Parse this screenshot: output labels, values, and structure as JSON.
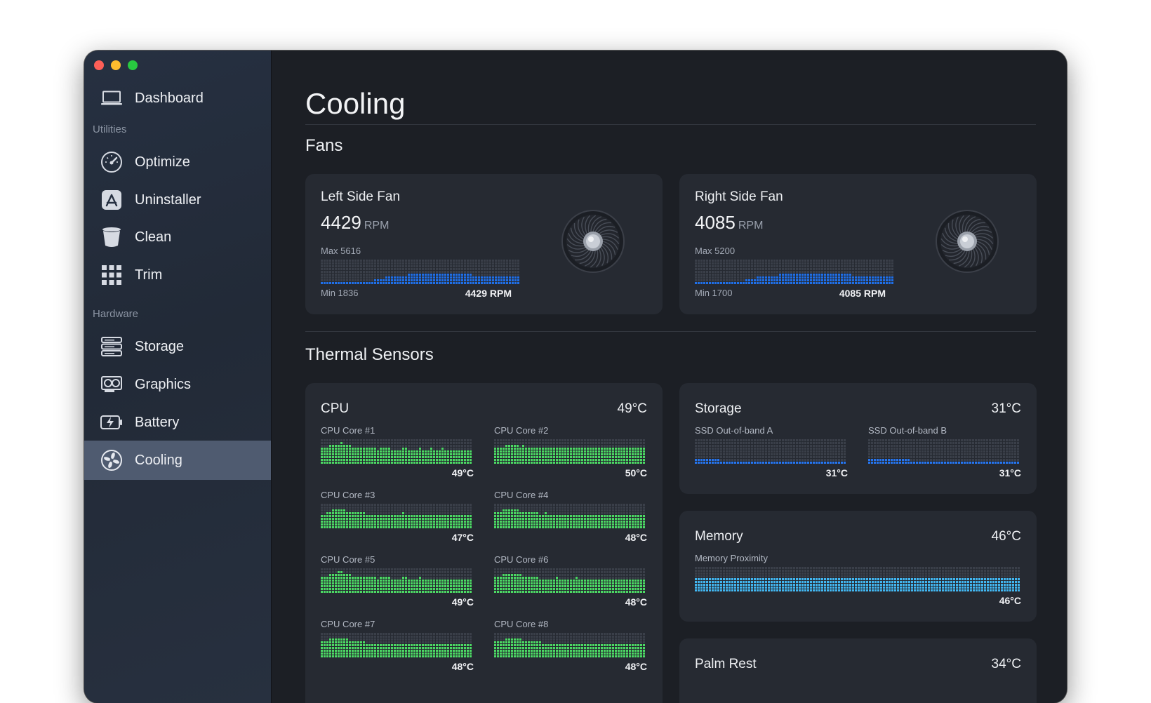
{
  "sidebar": {
    "dashboard": "Dashboard",
    "section_utilities": "Utilities",
    "optimize": "Optimize",
    "uninstaller": "Uninstaller",
    "clean": "Clean",
    "trim": "Trim",
    "section_hardware": "Hardware",
    "storage": "Storage",
    "graphics": "Graphics",
    "battery": "Battery",
    "cooling": "Cooling",
    "active_item": "Cooling"
  },
  "page": {
    "title": "Cooling",
    "fans_title": "Fans",
    "thermal_title": "Thermal Sensors"
  },
  "fans": [
    {
      "name": "Left Side Fan",
      "rpm": "4429",
      "unit": "RPM",
      "max_label": "Max 5616",
      "min_label": "Min 1836",
      "current_label": "4429 RPM",
      "max": 5616,
      "min": 1836,
      "history": [
        2300,
        2300,
        2300,
        2300,
        2300,
        2300,
        2300,
        2300,
        2300,
        2300,
        2300,
        2300,
        2300,
        2300,
        2300,
        2300,
        2350,
        2400,
        2500,
        2600,
        2700,
        2800,
        2900,
        3000,
        3050,
        3100,
        3150,
        3200,
        3250,
        3350,
        3450,
        3500,
        3550,
        3600,
        3600,
        3550,
        3500,
        3500,
        3500,
        3500,
        3450,
        3450,
        3450,
        3400,
        3400,
        3400,
        3400,
        3400,
        3350,
        3350,
        3350,
        3300,
        3300,
        3250,
        3200,
        3150,
        3100,
        3000,
        3000,
        3000,
        3000,
        3000,
        2950,
        2950,
        2950,
        2950,
        2950,
        2950
      ]
    },
    {
      "name": "Right Side Fan",
      "rpm": "4085",
      "unit": "RPM",
      "max_label": "Max 5200",
      "min_label": "Min 1700",
      "current_label": "4085 RPM",
      "max": 5200,
      "min": 1700,
      "history": [
        2200,
        2200,
        2200,
        2200,
        2200,
        2200,
        2200,
        2200,
        2200,
        2200,
        2200,
        2200,
        2200,
        2200,
        2200,
        2200,
        2250,
        2300,
        2400,
        2500,
        2600,
        2700,
        2800,
        2850,
        2900,
        2950,
        3000,
        3050,
        3100,
        3150,
        3250,
        3300,
        3350,
        3400,
        3400,
        3350,
        3300,
        3300,
        3300,
        3300,
        3250,
        3250,
        3250,
        3200,
        3200,
        3200,
        3200,
        3200,
        3150,
        3150,
        3150,
        3100,
        3100,
        3050,
        3000,
        2950,
        2900,
        2850,
        2850,
        2850,
        2850,
        2850,
        2800,
        2800,
        2800,
        2800,
        2800,
        2800
      ]
    }
  ],
  "thermal": {
    "cpu": {
      "title": "CPU",
      "temp": "49°C",
      "sensors": [
        {
          "name": "CPU Core #1",
          "temp": "49°C",
          "history": [
            50,
            52,
            54,
            56,
            55,
            58,
            60,
            57,
            55,
            54,
            53,
            53,
            52,
            51,
            51,
            53,
            50,
            50,
            50,
            49,
            50,
            50,
            52,
            50,
            49,
            49,
            49,
            50,
            51,
            49,
            49,
            49,
            49,
            50,
            49,
            49,
            49,
            50,
            49,
            49,
            49,
            50,
            49,
            49,
            49,
            49,
            49,
            49,
            49,
            49,
            49,
            49
          ]
        },
        {
          "name": "CPU Core #2",
          "temp": "50°C",
          "history": [
            50,
            51,
            53,
            54,
            55,
            57,
            56,
            54,
            53,
            55,
            52,
            52,
            51,
            51,
            52,
            51,
            50,
            51,
            50,
            50,
            50,
            51,
            50,
            50,
            50,
            50,
            50,
            51,
            50,
            50,
            50,
            50,
            50,
            50,
            50,
            50,
            50,
            50,
            50,
            50,
            50,
            50,
            50,
            50,
            50,
            50,
            50,
            50,
            50,
            50,
            50,
            50
          ]
        },
        {
          "name": "CPU Core #3",
          "temp": "47°C",
          "history": [
            49,
            51,
            53,
            54,
            55,
            58,
            56,
            54,
            53,
            52,
            52,
            51,
            51,
            50,
            50,
            49,
            49,
            49,
            48,
            48,
            48,
            49,
            48,
            48,
            49,
            48,
            48,
            51,
            48,
            48,
            48,
            48,
            48,
            48,
            48,
            48,
            48,
            48,
            47,
            47,
            48,
            47,
            47,
            47,
            47,
            47,
            47,
            47,
            47,
            47,
            47,
            47
          ]
        },
        {
          "name": "CPU Core #4",
          "temp": "48°C",
          "history": [
            50,
            53,
            55,
            56,
            54,
            57,
            56,
            54,
            53,
            52,
            51,
            52,
            50,
            50,
            50,
            49,
            49,
            50,
            49,
            48,
            49,
            49,
            48,
            48,
            49,
            48,
            48,
            49,
            48,
            48,
            48,
            48,
            48,
            48,
            48,
            48,
            48,
            48,
            48,
            48,
            48,
            48,
            48,
            48,
            48,
            48,
            48,
            48,
            48,
            48,
            48,
            48
          ]
        },
        {
          "name": "CPU Core #5",
          "temp": "49°C",
          "history": [
            50,
            52,
            54,
            56,
            55,
            59,
            60,
            57,
            55,
            54,
            53,
            53,
            52,
            51,
            51,
            50,
            50,
            50,
            50,
            49,
            50,
            50,
            51,
            50,
            49,
            49,
            49,
            50,
            50,
            49,
            49,
            49,
            49,
            50,
            49,
            49,
            49,
            49,
            49,
            49,
            49,
            49,
            49,
            49,
            49,
            49,
            49,
            49,
            49,
            49,
            49,
            49
          ]
        },
        {
          "name": "CPU Core #6",
          "temp": "48°C",
          "history": [
            50,
            52,
            54,
            55,
            56,
            58,
            57,
            55,
            54,
            53,
            52,
            51,
            51,
            50,
            50,
            49,
            49,
            49,
            49,
            49,
            49,
            50,
            49,
            49,
            49,
            49,
            49,
            50,
            49,
            49,
            48,
            48,
            48,
            48,
            48,
            48,
            48,
            48,
            48,
            48,
            48,
            48,
            48,
            48,
            48,
            48,
            48,
            48,
            48,
            48,
            48,
            48
          ]
        },
        {
          "name": "CPU Core #7",
          "temp": "48°C",
          "history": [
            50,
            52,
            54,
            56,
            56,
            58,
            57,
            55,
            54,
            53,
            52,
            52,
            51,
            50,
            50,
            49,
            49,
            49,
            49,
            48,
            49,
            49,
            49,
            49,
            49,
            48,
            48,
            49,
            49,
            48,
            48,
            48,
            48,
            48,
            48,
            48,
            48,
            48,
            48,
            48,
            48,
            48,
            48,
            48,
            48,
            48,
            48,
            48,
            48,
            48,
            48,
            48
          ]
        },
        {
          "name": "CPU Core #8",
          "temp": "48°C",
          "history": [
            50,
            52,
            53,
            55,
            55,
            58,
            57,
            55,
            54,
            53,
            52,
            52,
            51,
            50,
            50,
            50,
            49,
            49,
            49,
            48,
            49,
            49,
            48,
            48,
            48,
            48,
            48,
            49,
            48,
            48,
            48,
            48,
            48,
            48,
            48,
            48,
            48,
            48,
            48,
            48,
            48,
            48,
            48,
            48,
            48,
            48,
            48,
            48,
            48,
            48,
            48,
            48
          ]
        }
      ]
    },
    "storage": {
      "title": "Storage",
      "temp": "31°C",
      "sensors": [
        {
          "name": "SSD Out-of-band A",
          "temp": "31°C",
          "history": [
            32,
            32,
            32,
            32,
            32,
            32,
            32,
            32,
            31.5,
            31.5,
            31.5,
            31.5,
            31.5,
            31.5,
            31.5,
            31.5,
            31,
            31,
            31,
            31,
            31,
            31,
            31,
            31,
            31,
            31,
            31,
            31,
            31,
            31,
            31,
            31,
            31,
            31,
            31,
            31,
            31,
            31,
            31,
            31,
            31,
            31,
            31,
            31,
            31,
            31,
            31,
            31,
            31,
            31,
            31,
            31
          ]
        },
        {
          "name": "SSD Out-of-band B",
          "temp": "31°C",
          "history": [
            32,
            32,
            32,
            32,
            32,
            32,
            32,
            32,
            32,
            32,
            32,
            32,
            32,
            32,
            31.5,
            31.5,
            31.5,
            31,
            31,
            31,
            31,
            31,
            31,
            31,
            31,
            31,
            31,
            31,
            31,
            31,
            31,
            31,
            31,
            31,
            31,
            31,
            31,
            31,
            31,
            31,
            31,
            31,
            31,
            31,
            31,
            31,
            31,
            31,
            31,
            31,
            31,
            31
          ]
        }
      ]
    },
    "memory": {
      "title": "Memory",
      "temp": "46°C",
      "sensors": [
        {
          "name": "Memory Proximity",
          "temp": "46°C",
          "history": [
            46,
            46,
            46,
            46,
            46,
            46,
            46,
            46,
            46,
            46,
            46,
            46,
            46,
            46,
            46,
            46,
            46,
            46,
            46,
            46,
            46,
            46,
            46,
            46,
            46,
            46,
            46,
            46,
            46,
            46,
            46,
            46,
            46,
            46,
            46,
            46,
            46,
            46,
            46,
            46,
            46,
            46,
            46,
            46,
            46,
            46,
            46,
            46,
            46,
            46,
            46,
            46,
            46,
            46,
            46,
            46,
            46,
            46,
            46,
            46,
            46,
            46,
            46,
            47,
            47,
            47,
            47.5,
            47.5,
            47.5,
            47,
            47,
            46.5,
            46.5,
            46,
            46,
            46,
            46,
            46,
            46,
            46,
            46,
            46,
            46,
            46,
            46,
            46,
            46,
            46,
            46,
            46,
            46,
            46,
            46,
            46,
            46,
            46,
            46,
            46,
            46,
            46,
            46,
            46,
            46,
            46,
            46,
            46,
            46,
            46,
            46,
            46,
            46
          ]
        }
      ]
    },
    "palm_rest": {
      "title": "Palm Rest",
      "temp": "34°C"
    }
  },
  "colors": {
    "fan_bar": "#1f6fe8",
    "cpu_bar": "#4cd964",
    "storage_bar": "#2575f0",
    "memory_bar": "#42b6f0",
    "empty_cell": "#3a3f49",
    "active_nav": "#4f5b70"
  }
}
